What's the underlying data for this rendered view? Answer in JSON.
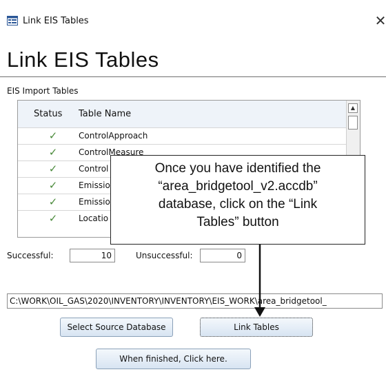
{
  "window": {
    "title": "Link EIS Tables",
    "close_glyph": "✕"
  },
  "form": {
    "heading": "Link EIS Tables",
    "group_label": "EIS Import Tables"
  },
  "table": {
    "columns": [
      "Status",
      "Table Name"
    ],
    "rows": [
      {
        "status_icon": "check-icon",
        "status_glyph": "✓",
        "name": "ControlApproach"
      },
      {
        "status_icon": "check-icon",
        "status_glyph": "✓",
        "name": "ControlMeasure"
      },
      {
        "status_icon": "check-icon",
        "status_glyph": "✓",
        "name": "Control"
      },
      {
        "status_icon": "check-icon",
        "status_glyph": "✓",
        "name": "Emissio"
      },
      {
        "status_icon": "check-icon",
        "status_glyph": "✓",
        "name": "Emissio"
      },
      {
        "status_icon": "check-icon",
        "status_glyph": "✓",
        "name": "Locatio"
      }
    ],
    "scroll_up_glyph": "▲",
    "scroll_down_glyph": "▼"
  },
  "counts": {
    "successful_label": "Successful:",
    "successful_value": "10",
    "unsuccessful_label": "Unsuccessful:",
    "unsuccessful_value": "0"
  },
  "path": {
    "value": "C:\\WORK\\OIL_GAS\\2020\\INVENTORY\\INVENTORY\\EIS_WORK\\area_bridgetool_"
  },
  "buttons": {
    "select_source": "Select Source Database",
    "link_tables": "Link Tables",
    "finished": "When finished, Click here."
  },
  "callout": {
    "lines": [
      "Once you have identified the",
      "“area_bridgetool_v2.accdb”",
      "database, click on the “Link",
      "Tables” button"
    ]
  },
  "colors": {
    "check": "#4a8a3a",
    "button_top": "#f4f8fc",
    "button_bottom": "#d7e4f2",
    "header_bg": "#eef3f9"
  }
}
